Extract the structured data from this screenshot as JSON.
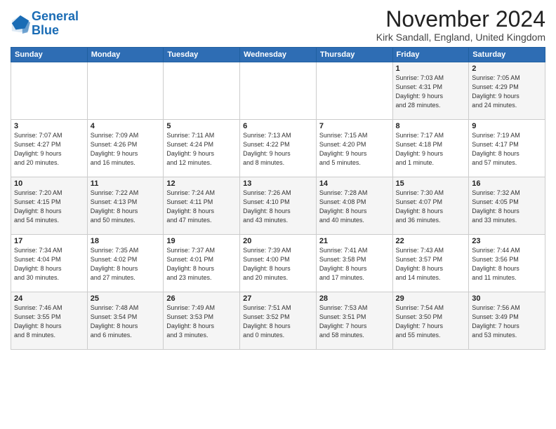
{
  "header": {
    "logo_line1": "General",
    "logo_line2": "Blue",
    "title": "November 2024",
    "location": "Kirk Sandall, England, United Kingdom"
  },
  "days_of_week": [
    "Sunday",
    "Monday",
    "Tuesday",
    "Wednesday",
    "Thursday",
    "Friday",
    "Saturday"
  ],
  "weeks": [
    [
      {
        "day": "",
        "info": ""
      },
      {
        "day": "",
        "info": ""
      },
      {
        "day": "",
        "info": ""
      },
      {
        "day": "",
        "info": ""
      },
      {
        "day": "",
        "info": ""
      },
      {
        "day": "1",
        "info": "Sunrise: 7:03 AM\nSunset: 4:31 PM\nDaylight: 9 hours\nand 28 minutes."
      },
      {
        "day": "2",
        "info": "Sunrise: 7:05 AM\nSunset: 4:29 PM\nDaylight: 9 hours\nand 24 minutes."
      }
    ],
    [
      {
        "day": "3",
        "info": "Sunrise: 7:07 AM\nSunset: 4:27 PM\nDaylight: 9 hours\nand 20 minutes."
      },
      {
        "day": "4",
        "info": "Sunrise: 7:09 AM\nSunset: 4:26 PM\nDaylight: 9 hours\nand 16 minutes."
      },
      {
        "day": "5",
        "info": "Sunrise: 7:11 AM\nSunset: 4:24 PM\nDaylight: 9 hours\nand 12 minutes."
      },
      {
        "day": "6",
        "info": "Sunrise: 7:13 AM\nSunset: 4:22 PM\nDaylight: 9 hours\nand 8 minutes."
      },
      {
        "day": "7",
        "info": "Sunrise: 7:15 AM\nSunset: 4:20 PM\nDaylight: 9 hours\nand 5 minutes."
      },
      {
        "day": "8",
        "info": "Sunrise: 7:17 AM\nSunset: 4:18 PM\nDaylight: 9 hours\nand 1 minute."
      },
      {
        "day": "9",
        "info": "Sunrise: 7:19 AM\nSunset: 4:17 PM\nDaylight: 8 hours\nand 57 minutes."
      }
    ],
    [
      {
        "day": "10",
        "info": "Sunrise: 7:20 AM\nSunset: 4:15 PM\nDaylight: 8 hours\nand 54 minutes."
      },
      {
        "day": "11",
        "info": "Sunrise: 7:22 AM\nSunset: 4:13 PM\nDaylight: 8 hours\nand 50 minutes."
      },
      {
        "day": "12",
        "info": "Sunrise: 7:24 AM\nSunset: 4:11 PM\nDaylight: 8 hours\nand 47 minutes."
      },
      {
        "day": "13",
        "info": "Sunrise: 7:26 AM\nSunset: 4:10 PM\nDaylight: 8 hours\nand 43 minutes."
      },
      {
        "day": "14",
        "info": "Sunrise: 7:28 AM\nSunset: 4:08 PM\nDaylight: 8 hours\nand 40 minutes."
      },
      {
        "day": "15",
        "info": "Sunrise: 7:30 AM\nSunset: 4:07 PM\nDaylight: 8 hours\nand 36 minutes."
      },
      {
        "day": "16",
        "info": "Sunrise: 7:32 AM\nSunset: 4:05 PM\nDaylight: 8 hours\nand 33 minutes."
      }
    ],
    [
      {
        "day": "17",
        "info": "Sunrise: 7:34 AM\nSunset: 4:04 PM\nDaylight: 8 hours\nand 30 minutes."
      },
      {
        "day": "18",
        "info": "Sunrise: 7:35 AM\nSunset: 4:02 PM\nDaylight: 8 hours\nand 27 minutes."
      },
      {
        "day": "19",
        "info": "Sunrise: 7:37 AM\nSunset: 4:01 PM\nDaylight: 8 hours\nand 23 minutes."
      },
      {
        "day": "20",
        "info": "Sunrise: 7:39 AM\nSunset: 4:00 PM\nDaylight: 8 hours\nand 20 minutes."
      },
      {
        "day": "21",
        "info": "Sunrise: 7:41 AM\nSunset: 3:58 PM\nDaylight: 8 hours\nand 17 minutes."
      },
      {
        "day": "22",
        "info": "Sunrise: 7:43 AM\nSunset: 3:57 PM\nDaylight: 8 hours\nand 14 minutes."
      },
      {
        "day": "23",
        "info": "Sunrise: 7:44 AM\nSunset: 3:56 PM\nDaylight: 8 hours\nand 11 minutes."
      }
    ],
    [
      {
        "day": "24",
        "info": "Sunrise: 7:46 AM\nSunset: 3:55 PM\nDaylight: 8 hours\nand 8 minutes."
      },
      {
        "day": "25",
        "info": "Sunrise: 7:48 AM\nSunset: 3:54 PM\nDaylight: 8 hours\nand 6 minutes."
      },
      {
        "day": "26",
        "info": "Sunrise: 7:49 AM\nSunset: 3:53 PM\nDaylight: 8 hours\nand 3 minutes."
      },
      {
        "day": "27",
        "info": "Sunrise: 7:51 AM\nSunset: 3:52 PM\nDaylight: 8 hours\nand 0 minutes."
      },
      {
        "day": "28",
        "info": "Sunrise: 7:53 AM\nSunset: 3:51 PM\nDaylight: 7 hours\nand 58 minutes."
      },
      {
        "day": "29",
        "info": "Sunrise: 7:54 AM\nSunset: 3:50 PM\nDaylight: 7 hours\nand 55 minutes."
      },
      {
        "day": "30",
        "info": "Sunrise: 7:56 AM\nSunset: 3:49 PM\nDaylight: 7 hours\nand 53 minutes."
      }
    ]
  ]
}
